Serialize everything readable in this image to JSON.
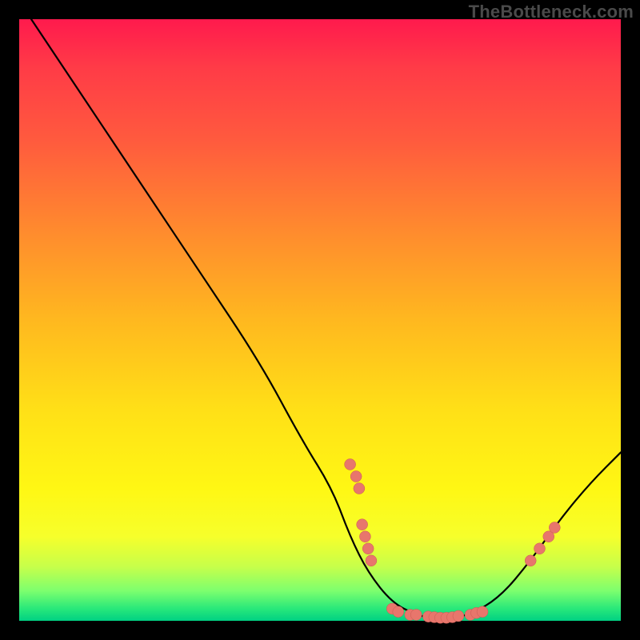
{
  "watermark": {
    "text": "TheBottleneck.com"
  },
  "colors": {
    "curve_stroke": "#000000",
    "marker_fill": "#e8766c",
    "marker_stroke": "#c95a52"
  },
  "chart_data": {
    "type": "line",
    "title": "",
    "xlabel": "",
    "ylabel": "",
    "xlim": [
      0,
      100
    ],
    "ylim": [
      0,
      100
    ],
    "curve": [
      {
        "x": 2,
        "y": 100
      },
      {
        "x": 10,
        "y": 88
      },
      {
        "x": 20,
        "y": 73
      },
      {
        "x": 30,
        "y": 58
      },
      {
        "x": 40,
        "y": 43
      },
      {
        "x": 47,
        "y": 30
      },
      {
        "x": 52,
        "y": 22
      },
      {
        "x": 55,
        "y": 14
      },
      {
        "x": 58,
        "y": 8
      },
      {
        "x": 62,
        "y": 3
      },
      {
        "x": 66,
        "y": 1
      },
      {
        "x": 70,
        "y": 0
      },
      {
        "x": 75,
        "y": 1
      },
      {
        "x": 80,
        "y": 4
      },
      {
        "x": 85,
        "y": 10
      },
      {
        "x": 90,
        "y": 17
      },
      {
        "x": 95,
        "y": 23
      },
      {
        "x": 100,
        "y": 28
      }
    ],
    "markers": [
      {
        "x": 55,
        "y": 26
      },
      {
        "x": 56,
        "y": 24
      },
      {
        "x": 56.5,
        "y": 22
      },
      {
        "x": 57,
        "y": 16
      },
      {
        "x": 57.5,
        "y": 14
      },
      {
        "x": 58,
        "y": 12
      },
      {
        "x": 58.5,
        "y": 10
      },
      {
        "x": 62,
        "y": 2
      },
      {
        "x": 63,
        "y": 1.5
      },
      {
        "x": 65,
        "y": 1
      },
      {
        "x": 66,
        "y": 1
      },
      {
        "x": 68,
        "y": 0.7
      },
      {
        "x": 69,
        "y": 0.6
      },
      {
        "x": 70,
        "y": 0.5
      },
      {
        "x": 71,
        "y": 0.5
      },
      {
        "x": 72,
        "y": 0.6
      },
      {
        "x": 73,
        "y": 0.8
      },
      {
        "x": 75,
        "y": 1
      },
      {
        "x": 76,
        "y": 1.3
      },
      {
        "x": 77,
        "y": 1.5
      },
      {
        "x": 85,
        "y": 10
      },
      {
        "x": 86.5,
        "y": 12
      },
      {
        "x": 88,
        "y": 14
      },
      {
        "x": 89,
        "y": 15.5
      }
    ]
  }
}
